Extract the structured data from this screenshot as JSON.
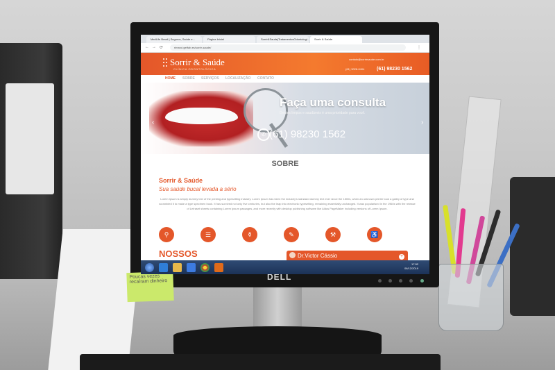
{
  "postit": {
    "lines": [
      "Poucas vezes",
      "recaíram dinheiro"
    ]
  },
  "monitor": {
    "brand": "DELL"
  },
  "browser": {
    "tabs": [
      "MedLife Brasil | Seguros, Saúde e...",
      "Página Inicial",
      "Sorrir&Saude|TratamentosOdontologi...",
      "Sorrir & Saúde"
    ],
    "url": "rimaroi.getfab.es/sorrir-saude/"
  },
  "site": {
    "brand": "Sorrir & Saúde",
    "tagline": "CLÍNICA ODONTOLÓGICA",
    "email": "contato@sorrirsaude.com.br",
    "phone_small": "(61) 3028-0404",
    "phone_header": "(61) 98230 1562",
    "menu": [
      "HOME",
      "SOBRE",
      "SERVIÇOS",
      "LOCALIZAÇÃO",
      "CONTATO"
    ],
    "banner_title": "Faça uma consulta",
    "banner_subtitle": "Dentes limpos e saudáveis é uma prioridade para você.",
    "banner_phone": "(61) 98230 1562",
    "section_title": "SOBRE",
    "about_name": "Sorrir & Saúde",
    "about_slogan": "Sua saúde bucal levada a sério",
    "about_text": "Lorem Ipsum is simply dummy text of the printing and typesetting industry. Lorem Ipsum has been the industry's standard dummy text ever since the 1500s, when an unknown printer took a galley of type and scrambled it to make a type specimen book. It has survived not only five centuries, but also the leap into electronic typesetting, remaining essentially unchanged. It was popularised in the 1960s with the release of Letraset sheets containing Lorem Ipsum passages, and more recently with desktop publishing software like Aldus PageMaker including versions of Lorem Ipsum.",
    "next_section": "NOSSOS",
    "chat_name": "Dr.Victor Cássio"
  },
  "taskbar": {
    "time": "17:52",
    "date": "06/12/2019"
  },
  "colors": {
    "accent": "#e4572a"
  }
}
